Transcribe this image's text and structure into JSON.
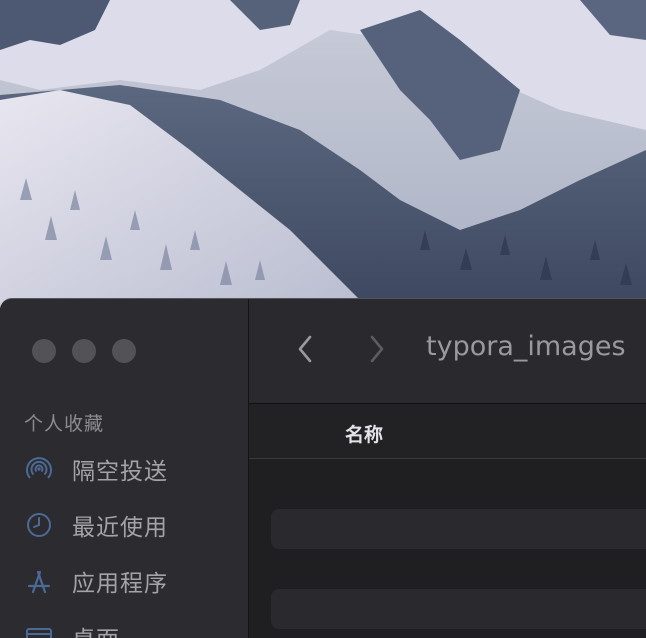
{
  "desktop": {
    "wallpaper": "snowy-mountain-forest"
  },
  "window": {
    "title": "typora_images",
    "traffic_lights": [
      "close",
      "minimize",
      "zoom"
    ],
    "sidebar": {
      "heading": "个人收藏",
      "items": [
        {
          "label": "隔空投送",
          "icon": "airdrop-icon"
        },
        {
          "label": "最近使用",
          "icon": "clock-icon"
        },
        {
          "label": "应用程序",
          "icon": "applications-icon"
        },
        {
          "label": "桌面",
          "icon": "desktop-icon"
        }
      ]
    },
    "toolbar": {
      "back": "back-chevron-icon",
      "forward": "forward-chevron-icon"
    },
    "list": {
      "column_name": "名称",
      "rows": [
        "",
        ""
      ]
    }
  },
  "colors": {
    "window_bg": "#262528",
    "sidebar_bg": "#2c2b2f",
    "accent_icon": "#3f5f8f",
    "text_primary": "#e4e3e8"
  }
}
